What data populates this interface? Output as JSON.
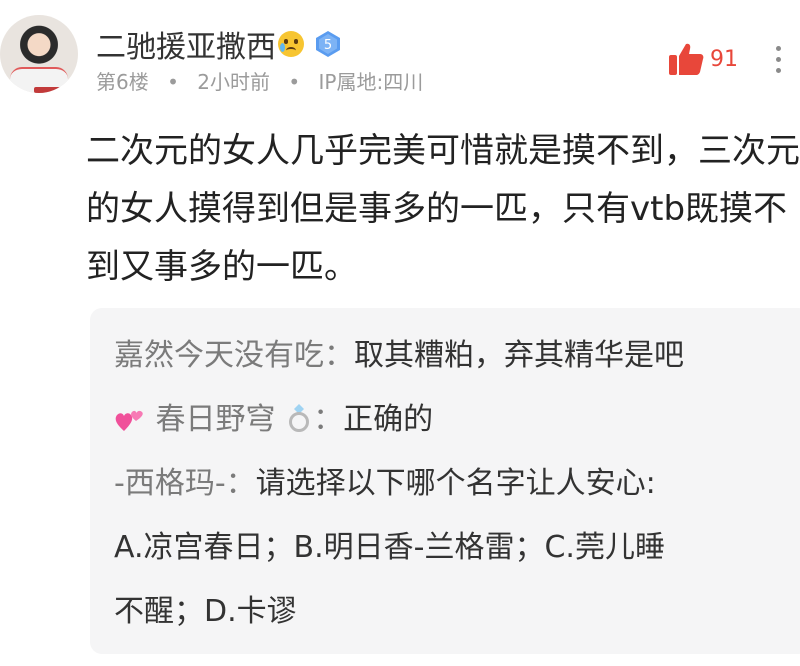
{
  "post": {
    "username": "二驰援亚撒西",
    "level": "5",
    "floor": "第6楼",
    "time": "2小时前",
    "location": "IP属地:四川",
    "like_count": "91",
    "content": "二次元的女人几乎完美可惜就是摸不到，三次元的女人摸得到但是事多的一匹，只有vtb既摸不到又事多的一匹。"
  },
  "replies": [
    {
      "user": "嘉然今天没有吃",
      "separator": "：",
      "text": "取其糟粕，弃其精华是吧"
    },
    {
      "user": "春日野穹",
      "separator": "：",
      "text": "正确的"
    },
    {
      "user": "-西格玛-",
      "separator": "：",
      "text": "请选择以下哪个名字让人安心:"
    }
  ],
  "reply3_continued": [
    "A.凉宫春日；B.明日香-兰格雷；C.莞儿睡",
    "不醒；D.卡谬"
  ],
  "icons": {
    "like": "thumbs-up-icon",
    "more": "more-vertical-icon",
    "level": "level-diamond-icon",
    "face": "crying-face-emoji-icon",
    "heart": "two-hearts-emoji-icon",
    "ring": "ring-emoji-icon"
  },
  "colors": {
    "like": "#e8473a",
    "level_badge": "#5a9cf0",
    "reply_background": "#f5f5f6",
    "meta_text": "#9b9b9b"
  }
}
